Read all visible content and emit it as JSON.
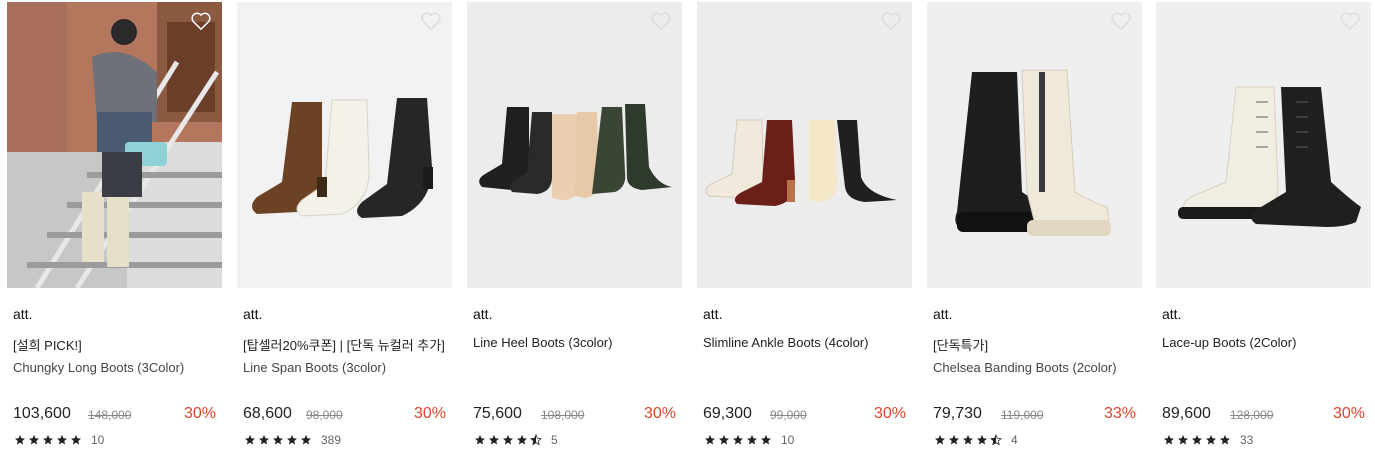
{
  "products": [
    {
      "brand": "att.",
      "title1": "[설희 PICK!]",
      "title2": "Chungky Long Boots (3Color)",
      "price": "103,600",
      "original_price": "148,000",
      "discount": "30%",
      "rating": 5,
      "review_count": "10",
      "image_bg": "#b77860",
      "image_desc": "model-photo"
    },
    {
      "brand": "att.",
      "title1": "[탑셀러20%쿠폰] | [단독 뉴컬러 추가]",
      "title2": "Line Span Boots (3color)",
      "price": "68,600",
      "original_price": "98,000",
      "discount": "30%",
      "rating": 5,
      "review_count": "389",
      "image_bg": "#f2f2f2"
    },
    {
      "brand": "att.",
      "title1": "Line Heel Boots (3color)",
      "title2": "",
      "price": "75,600",
      "original_price": "108,000",
      "discount": "30%",
      "rating": 4.5,
      "review_count": "5",
      "image_bg": "#ececec"
    },
    {
      "brand": "att.",
      "title1": "Slimline Ankle Boots (4color)",
      "title2": "",
      "price": "69,300",
      "original_price": "99,000",
      "discount": "30%",
      "rating": 5,
      "review_count": "10",
      "image_bg": "#ececec"
    },
    {
      "brand": "att.",
      "title1": "[단독특가]",
      "title2": "Chelsea Banding Boots (2color)",
      "price": "79,730",
      "original_price": "119,000",
      "discount": "33%",
      "rating": 4.5,
      "review_count": "4",
      "image_bg": "#efefef"
    },
    {
      "brand": "att.",
      "title1": "Lace-up Boots (2Color)",
      "title2": "",
      "price": "89,600",
      "original_price": "128,000",
      "discount": "30%",
      "rating": 5,
      "review_count": "33",
      "image_bg": "#efefef"
    }
  ],
  "icons": {
    "wishlist": "heart-outline-icon",
    "star": "star-icon"
  },
  "colors": {
    "discount": "#e0432b",
    "text": "#222222",
    "muted": "#888888"
  }
}
